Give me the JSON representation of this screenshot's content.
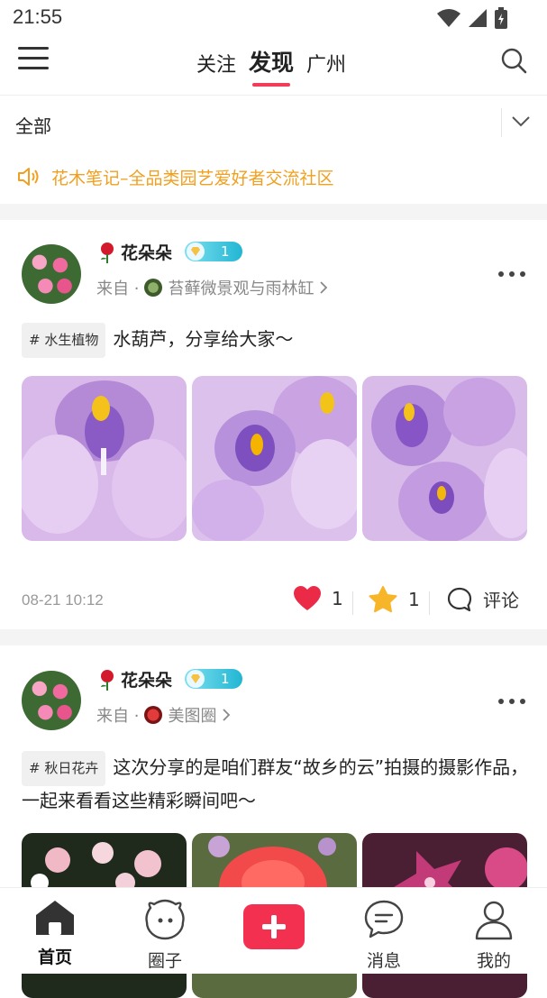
{
  "status_bar": {
    "time": "21:55"
  },
  "top_nav": {
    "tabs": [
      {
        "label": "关注"
      },
      {
        "label": "发现"
      },
      {
        "label": "广州"
      }
    ]
  },
  "filter": {
    "label": "全部"
  },
  "notice": {
    "text": "花木笔记–全品类园艺爱好者交流社区"
  },
  "posts": [
    {
      "user": "花朵朵",
      "level": "1",
      "from_prefix": "来自 ·",
      "circle": "苔藓微景观与雨林缸",
      "tag": "# 水生植物",
      "text": "水葫芦，分享给大家～",
      "time": "08-21 10:12",
      "likes": "1",
      "favorites": "1",
      "comment_label": "评论"
    },
    {
      "user": "花朵朵",
      "level": "1",
      "from_prefix": "来自 ·",
      "circle": "美图圈",
      "tag": "# 秋日花卉",
      "text": "这次分享的是咱们群友“故乡的云”拍摄的摄影作品，一起来看看这些精彩瞬间吧～"
    }
  ],
  "bottom_nav": [
    {
      "label": "首页",
      "icon": "home-icon"
    },
    {
      "label": "圈子",
      "icon": "circle-face-icon"
    },
    {
      "label": "",
      "icon": "plus-icon"
    },
    {
      "label": "消息",
      "icon": "message-icon"
    },
    {
      "label": "我的",
      "icon": "profile-icon"
    }
  ],
  "colors": {
    "accent": "#f23c5a",
    "notice": "#f0a020",
    "level_badge": "#21b6d4"
  }
}
